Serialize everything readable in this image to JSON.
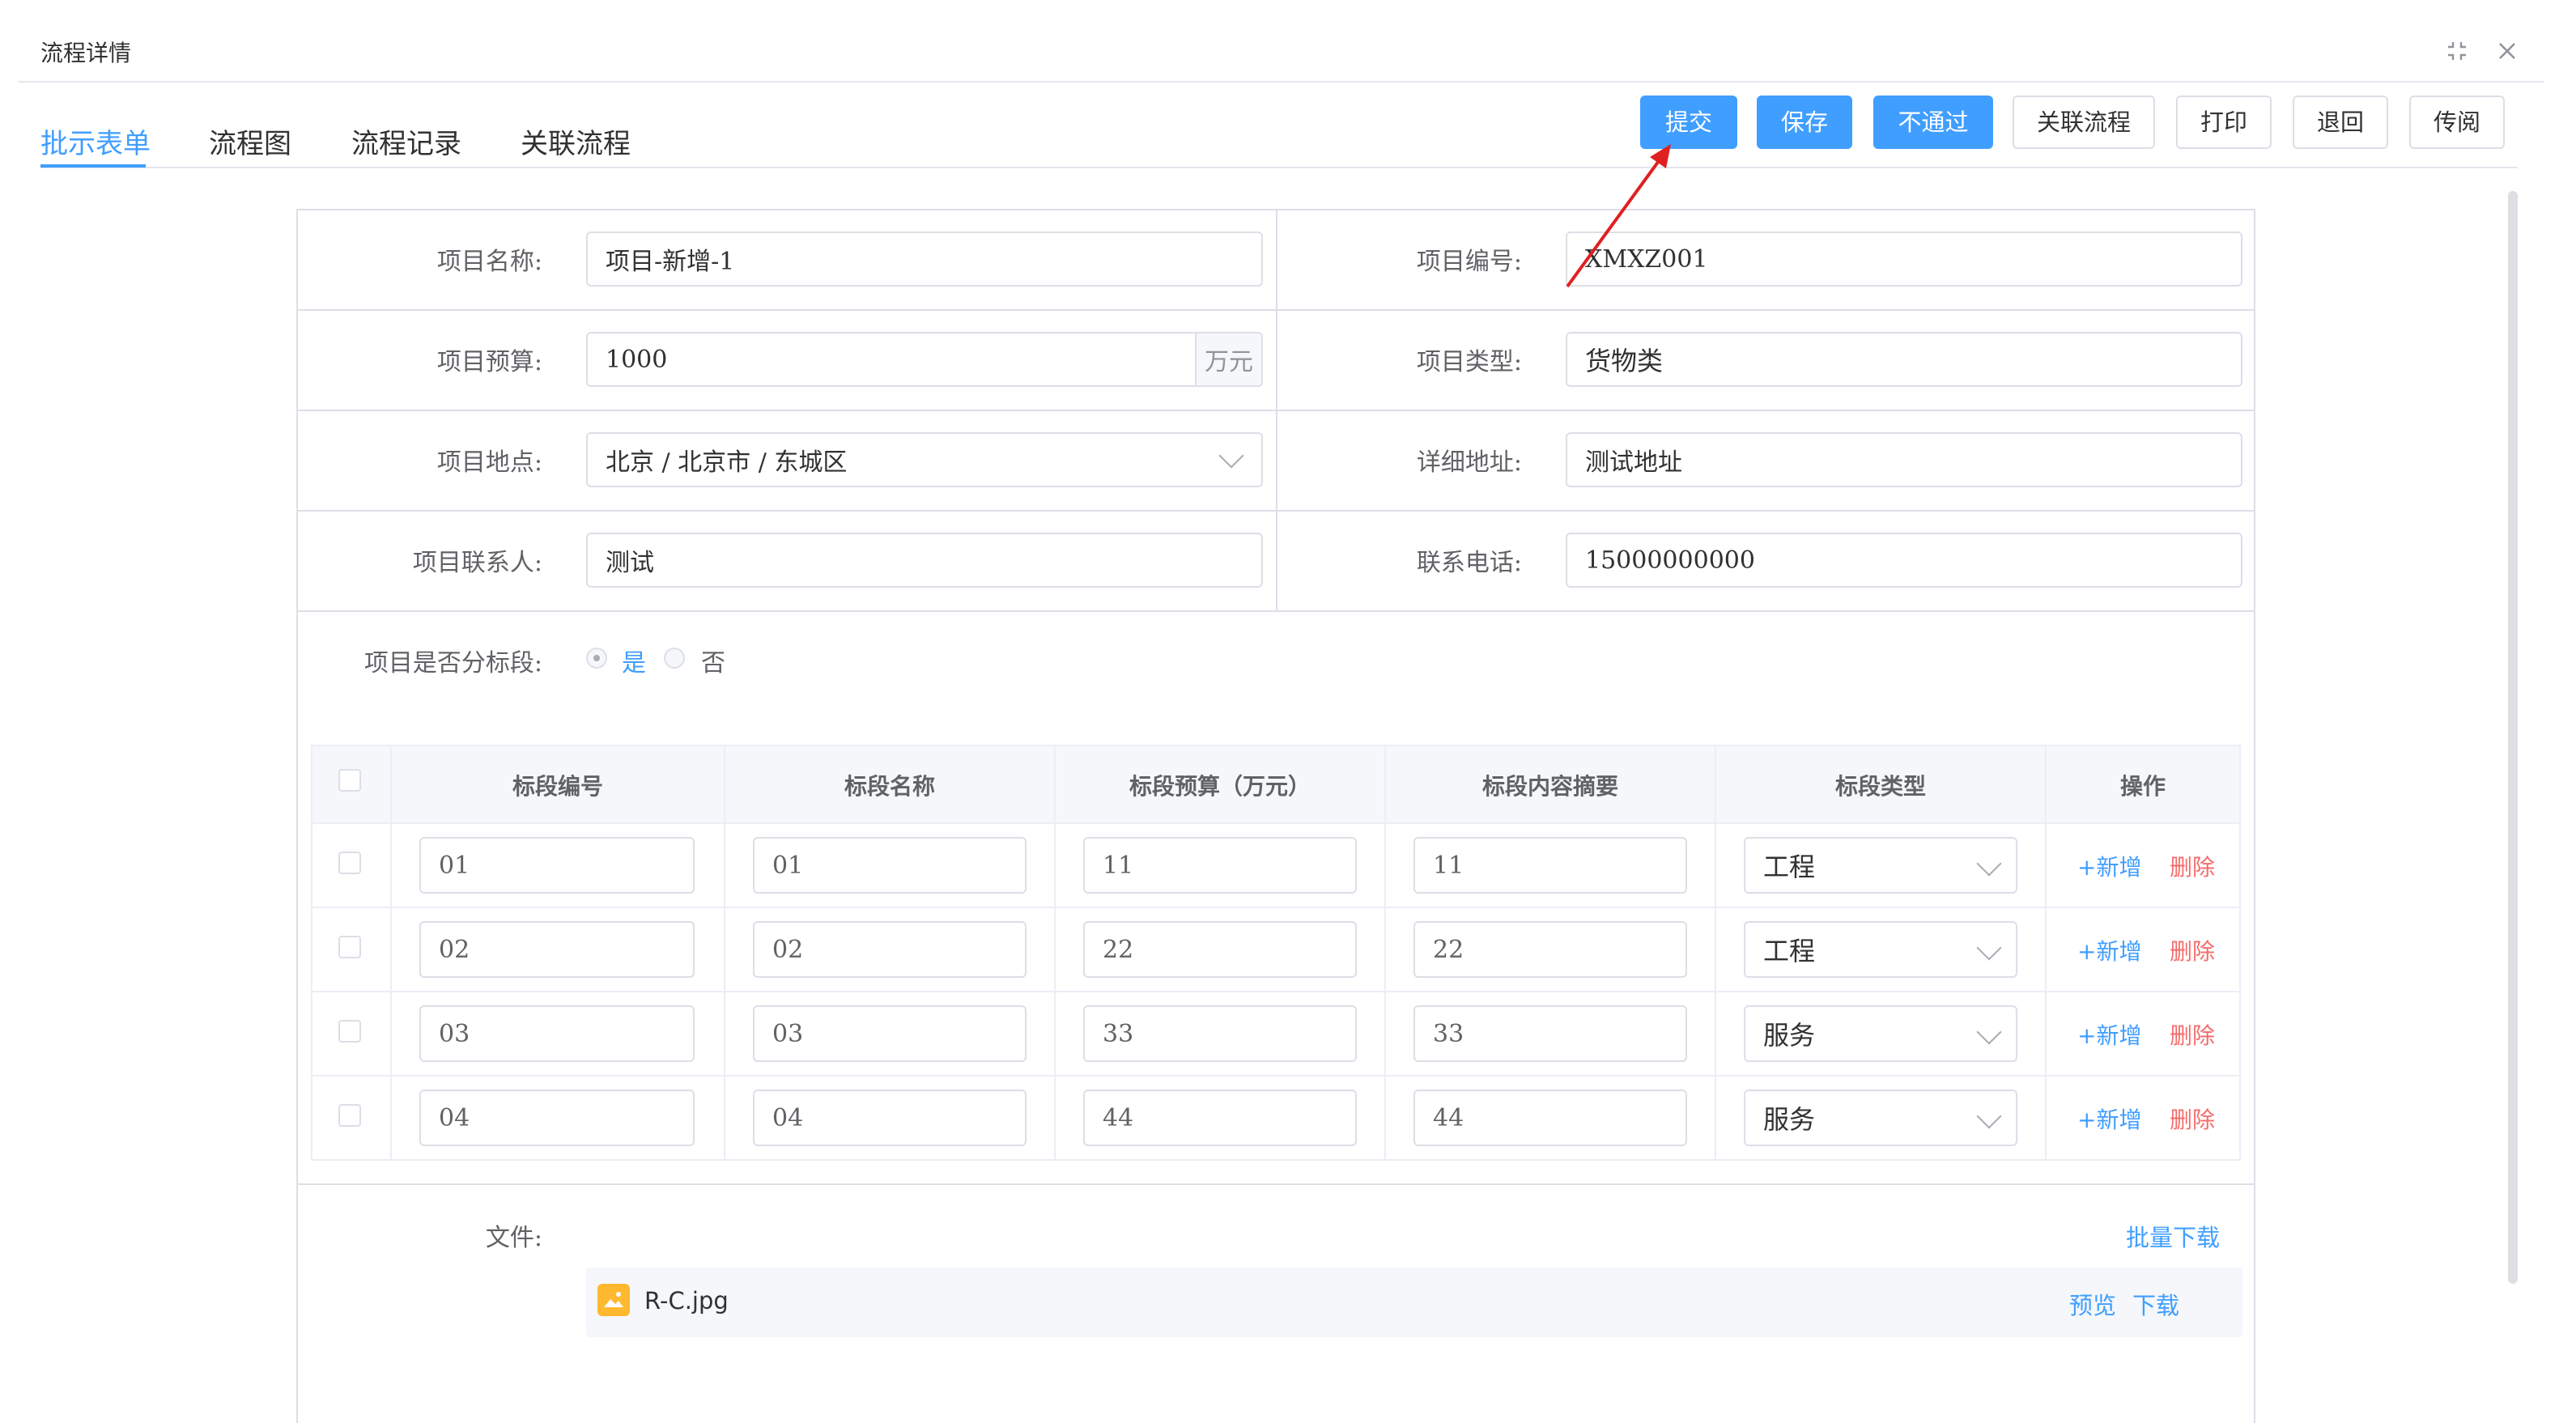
{
  "dialog": {
    "title": "流程详情"
  },
  "tabs": [
    {
      "label": "批示表单",
      "active": true
    },
    {
      "label": "流程图",
      "active": false
    },
    {
      "label": "流程记录",
      "active": false
    },
    {
      "label": "关联流程",
      "active": false
    }
  ],
  "toolbar": {
    "submit": "提交",
    "save": "保存",
    "reject": "不通过",
    "related": "关联流程",
    "print": "打印",
    "return": "退回",
    "circulate": "传阅"
  },
  "form": {
    "project_name": {
      "label": "项目名称:",
      "value": "项目-新增-1"
    },
    "project_code": {
      "label": "项目编号:",
      "value": "XMXZ001"
    },
    "budget": {
      "label": "项目预算:",
      "value": "1000",
      "unit": "万元"
    },
    "type": {
      "label": "项目类型:",
      "value": "货物类"
    },
    "location": {
      "label": "项目地点:",
      "value": "北京 / 北京市 / 东城区"
    },
    "address": {
      "label": "详细地址:",
      "value": "测试地址"
    },
    "contact": {
      "label": "项目联系人:",
      "value": "测试"
    },
    "phone": {
      "label": "联系电话:",
      "value": "15000000000"
    },
    "segmented": {
      "label": "项目是否分标段:",
      "yes": "是",
      "no": "否",
      "selected": "是"
    }
  },
  "table": {
    "headers": [
      "标段编号",
      "标段名称",
      "标段预算（万元）",
      "标段内容摘要",
      "标段类型",
      "操作"
    ],
    "add_label": "新增",
    "delete_label": "删除",
    "rows": [
      {
        "code": "01",
        "name": "01",
        "budget": "11",
        "summary": "11",
        "type": "工程"
      },
      {
        "code": "02",
        "name": "02",
        "budget": "22",
        "summary": "22",
        "type": "工程"
      },
      {
        "code": "03",
        "name": "03",
        "budget": "33",
        "summary": "33",
        "type": "服务"
      },
      {
        "code": "04",
        "name": "04",
        "budget": "44",
        "summary": "44",
        "type": "服务"
      }
    ]
  },
  "files": {
    "label": "文件:",
    "batch_download": "批量下载",
    "items": [
      {
        "name": "R-C.jpg",
        "preview": "预览",
        "download": "下载"
      }
    ]
  },
  "colors": {
    "primary": "#409eff",
    "danger": "#f56c6c",
    "annotation_arrow": "#e02020"
  }
}
